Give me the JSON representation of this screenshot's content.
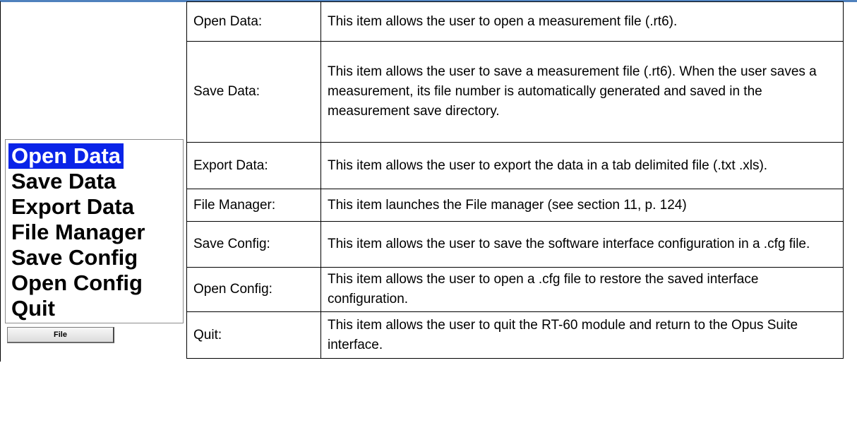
{
  "menu": {
    "items": [
      {
        "label": "Open Data",
        "selected": true
      },
      {
        "label": "Save Data",
        "selected": false
      },
      {
        "label": "Export Data",
        "selected": false
      },
      {
        "label": "File Manager",
        "selected": false
      },
      {
        "label": "Save Config",
        "selected": false
      },
      {
        "label": "Open Config",
        "selected": false
      },
      {
        "label": "Quit",
        "selected": false
      }
    ],
    "button_label": "File",
    "selection_color": "#0a24e8"
  },
  "table": {
    "rows": [
      {
        "name": "Open Data:",
        "description": "This item allows the user to open a measurement file (.rt6)."
      },
      {
        "name": "Save Data:",
        "description": "This item allows the user to save a measurement file (.rt6). When the user saves a measurement, its file number is automatically generated and saved in the measurement save directory."
      },
      {
        "name": "Export Data:",
        "description": "This item allows the user to export the data in a tab delimited file (.txt .xls)."
      },
      {
        "name": "File Manager:",
        "description": "This item launches the File manager (see section 11, p. 124)"
      },
      {
        "name": "Save Config:",
        "description": "This item allows the user to save the software interface configuration in a .cfg file."
      },
      {
        "name": "Open Config:",
        "description": "This item allows the user to open a .cfg file to restore the saved interface configuration."
      },
      {
        "name": "Quit:",
        "description": "This item allows the user to quit the RT-60 module and return to the Opus Suite interface."
      }
    ]
  },
  "colors": {
    "header_rule": "#4f81bd"
  }
}
